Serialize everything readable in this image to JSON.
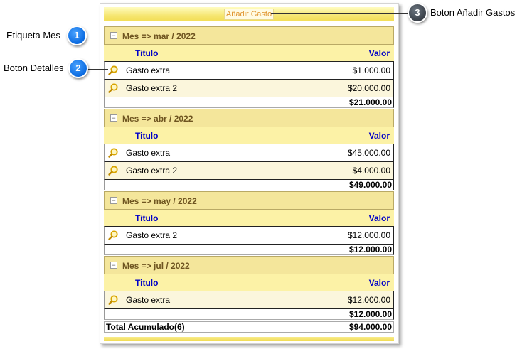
{
  "toolbar": {
    "add_expense_label": "Añadir Gasto"
  },
  "columns": {
    "title": "Titulo",
    "value": "Valor"
  },
  "groups": [
    {
      "label": "Mes => mar / 2022",
      "rows": [
        {
          "title": "Gasto extra",
          "value": "$1.000.00"
        },
        {
          "title": "Gasto extra 2",
          "value": "$20.000.00"
        }
      ],
      "subtotal": "$21.000.00"
    },
    {
      "label": "Mes => abr / 2022",
      "rows": [
        {
          "title": "Gasto extra",
          "value": "$45.000.00"
        },
        {
          "title": "Gasto extra 2",
          "value": "$4.000.00"
        }
      ],
      "subtotal": "$49.000.00"
    },
    {
      "label": "Mes => may / 2022",
      "rows": [
        {
          "title": "Gasto extra 2",
          "value": "$12.000.00"
        }
      ],
      "subtotal": "$12.000.00"
    },
    {
      "label": "Mes => jul / 2022",
      "rows": [
        {
          "title": "Gasto extra",
          "value": "$12.000.00"
        }
      ],
      "subtotal": "$12.000.00"
    }
  ],
  "total": {
    "label": "Total Acumulado(6)",
    "value": "$94.000.00"
  },
  "callouts": [
    {
      "number": "1",
      "label": "Etiqueta Mes"
    },
    {
      "number": "2",
      "label": "Boton Detalles"
    },
    {
      "number": "3",
      "label": "Boton Añadir Gastos"
    }
  ],
  "icons": {
    "toggle": "collapse-icon",
    "detail": "magnifier-icon"
  },
  "colors": {
    "header_band": "#f4e69b",
    "column_header": "#0000c8",
    "badge": "#0a6ae0"
  }
}
